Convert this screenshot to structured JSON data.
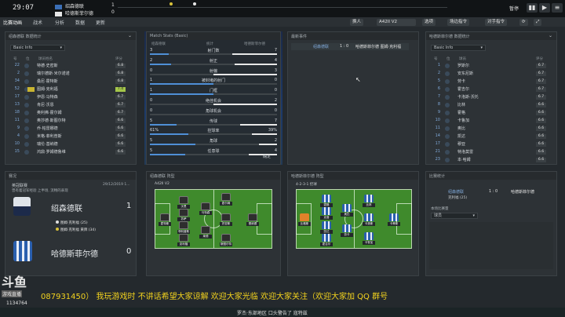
{
  "topbar": {
    "clock": "29:07",
    "home_team": "绍森德联",
    "away_team": "哈德斯菲尔德",
    "home_score": "1",
    "away_score": "0",
    "pause_label": "暂停"
  },
  "nav": {
    "items": [
      "比赛动画",
      "战术",
      "分析",
      "数据",
      "更新"
    ]
  },
  "actions": {
    "buttons": [
      "换人",
      "A42II V2",
      "选项",
      "场边指令",
      "对手指令"
    ]
  },
  "home_players": {
    "header": "绍森德联 数据统计",
    "select": "Basic Info",
    "columns": [
      "号",
      "位",
      "球员姓名",
      "评分"
    ],
    "rows": [
      {
        "num": "22",
        "name": "特德·史密斯",
        "rating": "6.8"
      },
      {
        "num": "2",
        "name": "瑞尔德斯·米尔诺诺",
        "rating": "6.8"
      },
      {
        "num": "34",
        "name": "桑尼·霍特斯",
        "rating": "6.8"
      },
      {
        "num": "52",
        "name": "图姆·克利福",
        "rating": "7.4"
      },
      {
        "num": "17",
        "name": "伊恩·马特森",
        "rating": "6.7"
      },
      {
        "num": "13",
        "name": "肯尼·沃恩",
        "rating": "6.7"
      },
      {
        "num": "18",
        "name": "奥利弗·霍尔姆",
        "rating": "6.7"
      },
      {
        "num": "11",
        "name": "奥莎德·斯图尔特",
        "rating": "6.6"
      },
      {
        "num": "9",
        "name": "乔·帕雷娜德",
        "rating": "6.6"
      },
      {
        "num": "4",
        "name": "米格·菲利普斯",
        "rating": "6.6"
      },
      {
        "num": "10",
        "name": "瑞伦·基纳德",
        "rating": "6.6"
      },
      {
        "num": "15",
        "name": "鸿鼎·罗姆德鲁维",
        "rating": "6.6"
      }
    ]
  },
  "match_stats": {
    "header": "Match Stats (Basic)",
    "columns": [
      "绍森德联",
      "统计",
      "哈德斯菲尔德"
    ],
    "rows": [
      {
        "left": "3",
        "label": "射门数",
        "right": "7",
        "lw": 0.3,
        "rw": 0.7
      },
      {
        "left": "2",
        "label": "射正",
        "right": "4",
        "lw": 0.33,
        "rw": 0.67
      },
      {
        "left": "0",
        "label": "射偏",
        "right": "3",
        "lw": 0.0,
        "rw": 1.0
      },
      {
        "left": "1",
        "label": "被封堵的射门",
        "right": "0",
        "lw": 1.0,
        "rw": 0.0
      },
      {
        "left": "1",
        "label": "门框",
        "right": "0",
        "lw": 1.0,
        "rw": 0.0
      },
      {
        "left": "0",
        "label": "绝佳机会",
        "right": "2",
        "lw": 0.0,
        "rw": 1.0
      },
      {
        "left": "0",
        "label": "角球机会",
        "right": "0",
        "lw": 0.0,
        "rw": 0.0
      },
      {
        "left": "5",
        "label": "传球",
        "right": "7",
        "lw": 0.42,
        "rw": 0.58
      },
      {
        "left": "61%",
        "label": "控球率",
        "right": "39%",
        "lw": 0.61,
        "rw": 0.39
      },
      {
        "left": "5",
        "label": "角球",
        "right": "2",
        "lw": 0.71,
        "rw": 0.29
      },
      {
        "left": "5",
        "label": "任意球",
        "right": "4",
        "lw": 0.56,
        "rw": 0.44
      }
    ],
    "confirm": "确定"
  },
  "events": {
    "header": "最新事件",
    "rows": [
      {
        "team": "绍森德联",
        "score": "1 : 0",
        "text": "哈德斯菲尔德 图姆·克利福"
      }
    ]
  },
  "away_players": {
    "header": "哈德斯菲尔德 数据统计",
    "select": "Basic Info",
    "columns": [
      "号",
      "位",
      "球员",
      "评分"
    ],
    "rows": [
      {
        "num": "1",
        "name": "罗斯尔",
        "rating": "6.7"
      },
      {
        "num": "2",
        "name": "安东尼斯",
        "rating": "6.7"
      },
      {
        "num": "5",
        "name": "劳卡",
        "rating": "6.7"
      },
      {
        "num": "6",
        "name": "霍吉尔",
        "rating": "6.7"
      },
      {
        "num": "7",
        "name": "卡洛斯·沃托",
        "rating": "6.7"
      },
      {
        "num": "8",
        "name": "比林",
        "rating": "6.6"
      },
      {
        "num": "9",
        "name": "霍格",
        "rating": "6.6"
      },
      {
        "num": "10",
        "name": "卡鲁加",
        "rating": "6.6"
      },
      {
        "num": "11",
        "name": "奥比",
        "rating": "6.6"
      },
      {
        "num": "14",
        "name": "凯达",
        "rating": "6.6"
      },
      {
        "num": "17",
        "name": "穆亚",
        "rating": "6.6"
      },
      {
        "num": "21",
        "name": "特洛莫雷",
        "rating": "6.6"
      },
      {
        "num": "23",
        "name": "本·哈姆",
        "rating": "6.6"
      }
    ]
  },
  "match_card": {
    "header": "赛况",
    "league": "英冠联赛",
    "date": "29/12/2019 1...",
    "desc": "曾有着冠军经验 上半场, 流畅的表现",
    "home_name": "绍森德联",
    "home_score": "1",
    "goal1": "图姆·克利福 (25)",
    "goal2": "图姆·克利福 黄牌 (34)",
    "away_name": "哈德斯菲尔德",
    "away_score": "0"
  },
  "home_formation": {
    "header": "绍森德联 阵型",
    "label": "A42II V2",
    "players": [
      "霍特斯",
      "沃恩",
      "苏萨",
      "菲利普斯",
      "克利福",
      "马特森",
      "莱德",
      "霍尔姆",
      "史密斯",
      "斯图尔特",
      "基纳德"
    ]
  },
  "away_formation": {
    "header": "哈德斯菲尔德 阵型",
    "label": "4-2-3-1 控球",
    "players": [
      "比格斯",
      "霍格",
      "克洛",
      "凯达",
      "霍吉尔",
      "奥比",
      "劳卡",
      "比林",
      "卡洛斯",
      "卡鲁加",
      "卡蒂斯"
    ]
  },
  "small_stats": {
    "header": "比赛统计",
    "home_team": "绍森德联",
    "score": "1 : 0",
    "away_team": "哈德斯菲尔德",
    "home_scorer": "克利福 (25)",
    "section": "本场比赛量",
    "select": "球员"
  },
  "stream": {
    "logo": "斗鱼",
    "logo_sub": "游戏直播",
    "room": "1134764",
    "banner": "087931450） 我玩游戏时 不讲话希望大家谅解 欢迎大家光临 欢迎大家关注（欢迎大家加 QQ 群号",
    "bottom_msg": "罗杰·东部地区 口头警告了 寇特兹"
  },
  "colors": {
    "home": "#3b6fb6",
    "away": "#e6e6e6",
    "accent": "#a4c64a",
    "banner": "#f2d21e"
  }
}
